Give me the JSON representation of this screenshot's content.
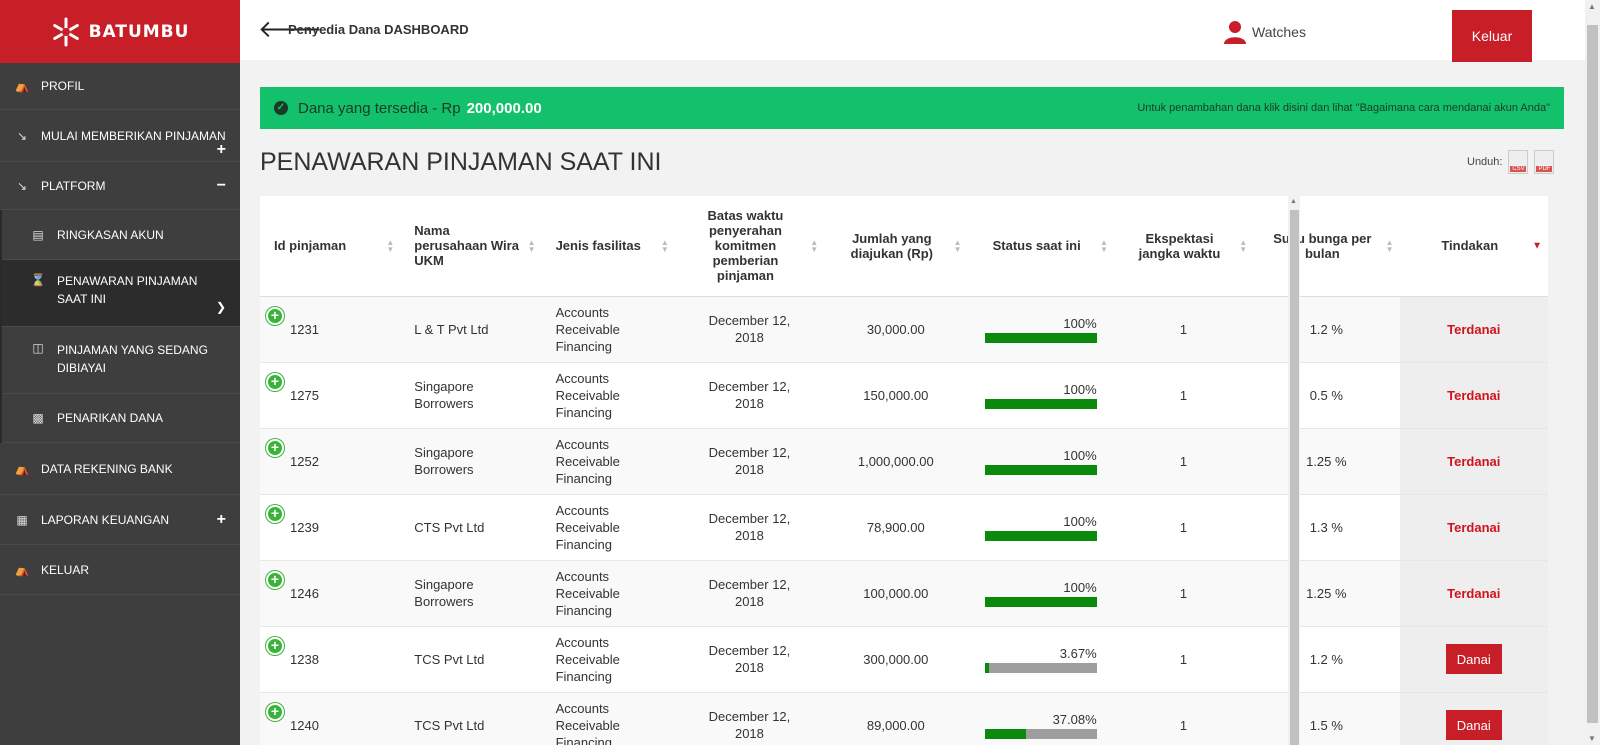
{
  "brand": {
    "name": "BATUMBU",
    "color": "#c81e28"
  },
  "sidebar": {
    "items": [
      {
        "label": "PROFIL",
        "icon": "bank-icon"
      },
      {
        "label": "MULAI MEMBERIKAN PINJAMAN",
        "icon": "chart-line-icon",
        "toggle": "+"
      },
      {
        "label": "PLATFORM",
        "icon": "chart-line-icon",
        "toggle": "−"
      },
      {
        "label": "DATA REKENING BANK",
        "icon": "bank-icon"
      },
      {
        "label": "LAPORAN KEUANGAN",
        "icon": "calculator-icon",
        "toggle": "+"
      },
      {
        "label": "KELUAR",
        "icon": "bank-icon"
      }
    ],
    "platform_sub": [
      {
        "label": "RINGKASAN AKUN",
        "icon": "document-icon"
      },
      {
        "label": "PENAWARAN PINJAMAN SAAT INI",
        "icon": "hourglass-icon"
      },
      {
        "label": "PINJAMAN YANG SEDANG DIBIAYAI",
        "icon": "sitemap-icon"
      },
      {
        "label": "PENARIKAN DANA",
        "icon": "money-icon"
      }
    ]
  },
  "header": {
    "title": "Penyedia Dana DASHBOARD",
    "watches": "Watches",
    "logout": "Keluar"
  },
  "alert": {
    "label": "Dana yang tersedia - Rp",
    "amount": "200,000.00",
    "hint": "Untuk penambahan dana klik disini dan lihat \"Bagaimana cara mendanai akun Anda\""
  },
  "page": {
    "title": "PENAWARAN PINJAMAN SAAT INI",
    "download_label": "Unduh:",
    "csv": "CSV",
    "pdf": "PDF"
  },
  "table": {
    "headers": [
      "Id pinjaman",
      "Nama perusahaan Wira UKM",
      "Jenis fasilitas",
      "Batas waktu penyerahan komitmen pemberian pinjaman",
      "Jumlah yang diajukan (Rp)",
      "Status saat ini",
      "Ekspektasi jangka waktu",
      "Suku bunga per bulan",
      "Tindakan"
    ],
    "rows": [
      {
        "id": "1231",
        "company": "L & T Pvt Ltd",
        "facility": "Accounts Receivable Financing",
        "deadline": "December 12, 2018",
        "amount": "30,000.00",
        "status": "100%",
        "progress": 100,
        "term": "1",
        "rate": "1.2 %",
        "action": "Terdanai",
        "funded": true
      },
      {
        "id": "1275",
        "company": "Singapore Borrowers",
        "facility": "Accounts Receivable Financing",
        "deadline": "December 12, 2018",
        "amount": "150,000.00",
        "status": "100%",
        "progress": 100,
        "term": "1",
        "rate": "0.5 %",
        "action": "Terdanai",
        "funded": true
      },
      {
        "id": "1252",
        "company": "Singapore Borrowers",
        "facility": "Accounts Receivable Financing",
        "deadline": "December 12, 2018",
        "amount": "1,000,000.00",
        "status": "100%",
        "progress": 100,
        "term": "1",
        "rate": "1.25 %",
        "action": "Terdanai",
        "funded": true
      },
      {
        "id": "1239",
        "company": "CTS Pvt Ltd",
        "facility": "Accounts Receivable Financing",
        "deadline": "December 12, 2018",
        "amount": "78,900.00",
        "status": "100%",
        "progress": 100,
        "term": "1",
        "rate": "1.3 %",
        "action": "Terdanai",
        "funded": true
      },
      {
        "id": "1246",
        "company": "Singapore Borrowers",
        "facility": "Accounts Receivable Financing",
        "deadline": "December 12, 2018",
        "amount": "100,000.00",
        "status": "100%",
        "progress": 100,
        "term": "1",
        "rate": "1.25 %",
        "action": "Terdanai",
        "funded": true
      },
      {
        "id": "1238",
        "company": "TCS Pvt Ltd",
        "facility": "Accounts Receivable Financing",
        "deadline": "December 12, 2018",
        "amount": "300,000.00",
        "status": "3.67%",
        "progress": 3.67,
        "term": "1",
        "rate": "1.2 %",
        "action": "Danai",
        "funded": false
      },
      {
        "id": "1240",
        "company": "TCS Pvt Ltd",
        "facility": "Accounts Receivable Financing",
        "deadline": "December 12, 2018",
        "amount": "89,000.00",
        "status": "37.08%",
        "progress": 37.08,
        "term": "1",
        "rate": "1.5 %",
        "action": "Danai",
        "funded": false
      }
    ]
  },
  "colors": {
    "success": "#13c16d",
    "progress_fill": "#0a8a0a",
    "progress_empty": "#9e9e9e",
    "action_red": "#d0131c"
  }
}
